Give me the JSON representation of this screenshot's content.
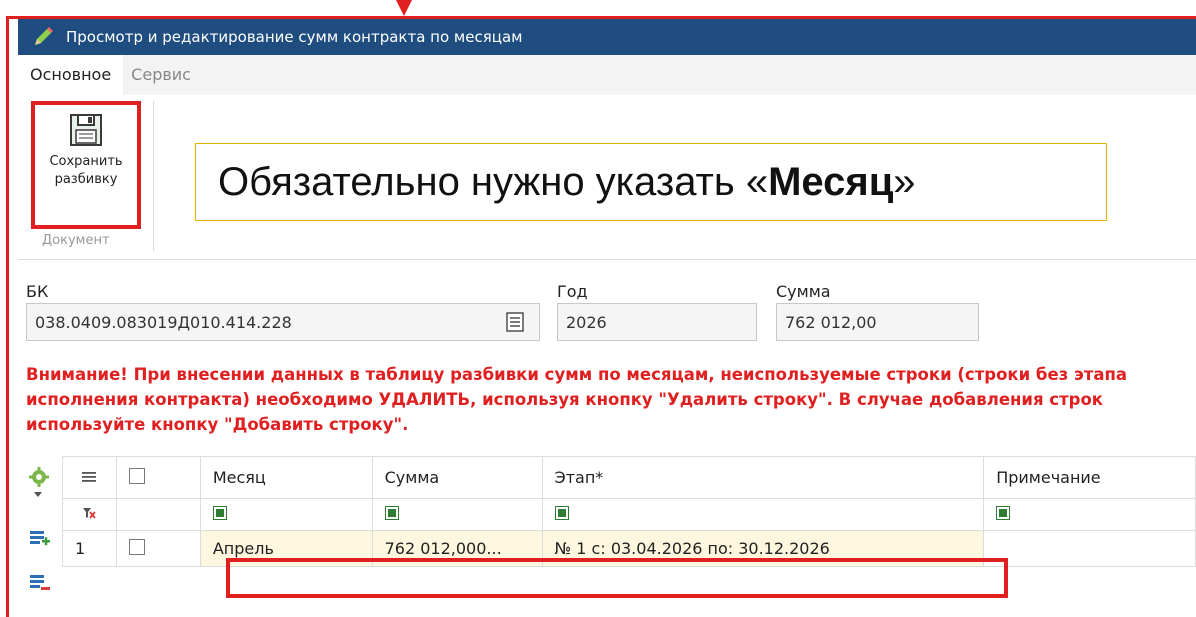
{
  "window": {
    "title": "Просмотр и редактирование сумм контракта по месяцам"
  },
  "ribbon": {
    "tabs": [
      {
        "label": "Основное",
        "active": true
      },
      {
        "label": "Сервис",
        "active": false
      }
    ],
    "save_button": {
      "line1": "Сохранить",
      "line2": "разбивку"
    },
    "group_label": "Документ"
  },
  "callout": {
    "prefix": "Обязательно нужно указать «",
    "bold": "Месяц",
    "suffix": "»"
  },
  "fields": {
    "bk": {
      "label": "БК",
      "value": "038.0409.083019Д010.414.228"
    },
    "year": {
      "label": "Год",
      "value": "2026"
    },
    "sum": {
      "label": "Сумма",
      "value": "762 012,00"
    }
  },
  "warning": "Внимание! При внесении данных в таблицу разбивки сумм по месяцам, неиспользуемые строки (строки без этапа исполнения контракта) необходимо УДАЛИТЬ, используя кнопку \"Удалить строку\". В случае добавления строк используйте кнопку \"Добавить строку\".",
  "grid": {
    "columns": {
      "month": "Месяц",
      "sum": "Сумма",
      "stage": "Этап*",
      "note": "Примечание"
    },
    "rows": [
      {
        "num": "1",
        "month": "Апрель",
        "sum": "762 012,000...",
        "stage": "№ 1 с: 03.04.2026 по: 30.12.2026",
        "note": ""
      }
    ]
  },
  "colors": {
    "titlebar": "#1f4d80",
    "highlight": "#e02020",
    "warning": "#e02020",
    "sum_text": "#2e7d32"
  }
}
